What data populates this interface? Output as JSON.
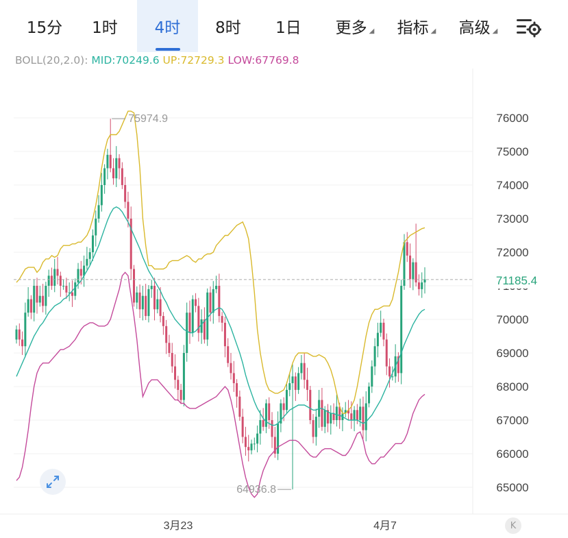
{
  "tabs": [
    {
      "label": "15分",
      "active": false,
      "dropdown": false
    },
    {
      "label": "1时",
      "active": false,
      "dropdown": false
    },
    {
      "label": "4时",
      "active": true,
      "dropdown": false
    },
    {
      "label": "8时",
      "active": false,
      "dropdown": false
    },
    {
      "label": "1日",
      "active": false,
      "dropdown": false
    },
    {
      "label": "更多",
      "active": false,
      "dropdown": true
    },
    {
      "label": "指标",
      "active": false,
      "dropdown": true
    },
    {
      "label": "高级",
      "active": false,
      "dropdown": true
    }
  ],
  "toolbar": {
    "settings_icon": "chart-settings-icon"
  },
  "indicator": {
    "name": "BOLL(20,2.0):",
    "mid_label": "MID:70249.6",
    "up_label": "UP:72729.3",
    "low_label": "LOW:67769.8"
  },
  "colors": {
    "up": "#27a37a",
    "down": "#d24f6e",
    "mid": "#2bb3a0",
    "upper": "#d9b92c",
    "lower": "#c44a9b",
    "accent": "#2f6fd6",
    "axis_text": "#444444",
    "current_price": "#27a37a"
  },
  "chart_data": {
    "type": "candlestick",
    "ylim": [
      64500,
      76600
    ],
    "yticks": [
      65000,
      66000,
      67000,
      68000,
      69000,
      70000,
      71000,
      72000,
      73000,
      74000,
      75000,
      76000
    ],
    "xticks": [
      "3月23",
      "4月7"
    ],
    "current_price": "71185.4",
    "max_label": "75974.9",
    "min_label": "64936.8",
    "closes": [
      69700,
      69400,
      69200,
      70200,
      70600,
      70200,
      71000,
      70500,
      70700,
      70400,
      71000,
      71300,
      71000,
      71500,
      71300,
      71000,
      71000,
      70800,
      70800,
      70700,
      71100,
      71500,
      71300,
      71600,
      71800,
      72000,
      72500,
      73000,
      73400,
      74000,
      74500,
      74900,
      74500,
      74200,
      74800,
      74500,
      74000,
      73500,
      73000,
      71500,
      70500,
      70800,
      70300,
      70700,
      70100,
      70900,
      71000,
      70300,
      70600,
      70100,
      69800,
      69300,
      69000,
      68600,
      68200,
      67900,
      67600,
      69000,
      70200,
      69600,
      70600,
      70400,
      69600,
      70000,
      69400,
      70800,
      70200,
      70900,
      71000,
      70100,
      69900,
      69200,
      68700,
      68400,
      68100,
      67700,
      67100,
      66500,
      66200,
      66100,
      66300,
      66300,
      66600,
      67000,
      66800,
      67500,
      67000,
      66500,
      66000,
      66900,
      67500,
      67300,
      67900,
      68100,
      68300,
      67900,
      68400,
      68700,
      68200,
      67900,
      67000,
      66500,
      67100,
      67600,
      66800,
      67300,
      66900,
      67200,
      67000,
      67400,
      67000,
      67200,
      67300,
      67200,
      67000,
      67300,
      67000,
      67400,
      66700,
      67500,
      68000,
      68600,
      69200,
      69600,
      69900,
      69400,
      68600,
      68300,
      68300,
      68900,
      68400,
      71000,
      72300,
      71900,
      71200,
      71700,
      71100,
      70900,
      71100,
      71190
    ],
    "max_high": 75974.9,
    "max_index": 32,
    "min_low": 64936.8,
    "min_index": 94,
    "max_index_2": 136,
    "max_high_2": 72850,
    "gap_index_4": 125,
    "gap_low_4": 69200,
    "mid": [
      68300,
      68500,
      68700,
      68900,
      69100,
      69300,
      69500,
      69650,
      69800,
      69900,
      70050,
      70200,
      70300,
      70400,
      70450,
      70500,
      70600,
      70650,
      70750,
      70850,
      70950,
      71050,
      71150,
      71300,
      71450,
      71600,
      71800,
      72000,
      72200,
      72450,
      72700,
      72950,
      73150,
      73300,
      73350,
      73300,
      73200,
      73050,
      72900,
      72700,
      72500,
      72300,
      72100,
      71850,
      71650,
      71450,
      71300,
      71150,
      71000,
      70850,
      70650,
      70500,
      70300,
      70150,
      70000,
      69900,
      69800,
      69700,
      69650,
      69600,
      69600,
      69650,
      69750,
      69850,
      69950,
      70050,
      70150,
      70250,
      70300,
      70350,
      70300,
      70150,
      69950,
      69750,
      69500,
      69250,
      69000,
      68700,
      68350,
      68050,
      67800,
      67550,
      67350,
      67200,
      67050,
      66950,
      66900,
      66850,
      66850,
      66900,
      67000,
      67100,
      67200,
      67300,
      67350,
      67400,
      67450,
      67450,
      67450,
      67400,
      67350,
      67300,
      67300,
      67350,
      67350,
      67300,
      67250,
      67200,
      67200,
      67150,
      67150,
      67100,
      67050,
      67000,
      67000,
      67000,
      67000,
      66950,
      66900,
      66950,
      67050,
      67150,
      67300,
      67450,
      67600,
      67800,
      68000,
      68200,
      68400,
      68600,
      68800,
      69000,
      69250,
      69450,
      69650,
      69850,
      70000,
      70150,
      70250,
      70300
    ],
    "upper": [
      71100,
      71200,
      71350,
      71500,
      71550,
      71550,
      71550,
      71400,
      71500,
      71700,
      71800,
      71800,
      71900,
      71850,
      71900,
      72100,
      72200,
      72200,
      72200,
      72250,
      72250,
      72300,
      72300,
      72400,
      72500,
      72700,
      73000,
      73400,
      73900,
      74500,
      75000,
      75350,
      75500,
      75500,
      75500,
      75600,
      75800,
      76000,
      76200,
      76200,
      76150,
      75500,
      74500,
      73000,
      72200,
      71600,
      71600,
      71500,
      71500,
      71500,
      71500,
      71550,
      71700,
      71750,
      71750,
      71750,
      71800,
      71850,
      71900,
      71850,
      71750,
      71700,
      71800,
      71800,
      71900,
      71950,
      71950,
      72000,
      72200,
      72300,
      72400,
      72500,
      72500,
      72600,
      72700,
      72800,
      72850,
      72900,
      72700,
      72400,
      71700,
      70800,
      69700,
      69000,
      68500,
      68100,
      67900,
      67850,
      67800,
      67800,
      67850,
      67900,
      68100,
      68400,
      68700,
      68900,
      69000,
      69000,
      69000,
      69000,
      68950,
      68900,
      68900,
      68950,
      68900,
      68850,
      68700,
      68500,
      68200,
      67800,
      67400,
      67200,
      67200,
      67300,
      67400,
      67600,
      68000,
      68500,
      69000,
      69500,
      69900,
      70150,
      70300,
      70300,
      70350,
      70400,
      70400,
      70400,
      70600,
      71000,
      71400,
      71900,
      72300,
      72400,
      72500,
      72550,
      72600,
      72650,
      72700,
      72729
    ],
    "lower": [
      65200,
      65300,
      65600,
      66100,
      66700,
      67400,
      68000,
      68400,
      68600,
      68700,
      68700,
      68700,
      68800,
      68900,
      69000,
      69100,
      69100,
      69150,
      69200,
      69300,
      69400,
      69550,
      69700,
      69800,
      69850,
      69900,
      69900,
      69850,
      69800,
      69800,
      69800,
      69850,
      70000,
      70300,
      70600,
      70900,
      71300,
      71400,
      71300,
      70700,
      70100,
      69400,
      68500,
      67700,
      67900,
      68100,
      68200,
      68200,
      68200,
      68100,
      68000,
      67900,
      67800,
      67700,
      67600,
      67600,
      67500,
      67500,
      67400,
      67350,
      67350,
      67350,
      67400,
      67450,
      67500,
      67550,
      67600,
      67650,
      67700,
      67800,
      67900,
      68000,
      67900,
      67600,
      67200,
      66700,
      66200,
      65700,
      65300,
      65000,
      64800,
      64700,
      64800,
      65200,
      65500,
      65700,
      65900,
      66000,
      66100,
      66200,
      66250,
      66300,
      66350,
      66400,
      66400,
      66400,
      66350,
      66250,
      66150,
      66050,
      65950,
      65900,
      65900,
      66000,
      66100,
      66150,
      66150,
      66150,
      66100,
      66050,
      66000,
      65950,
      65950,
      66050,
      66200,
      66400,
      66600,
      66650,
      66400,
      66000,
      65800,
      65700,
      65700,
      65800,
      65900,
      65900,
      66000,
      66100,
      66200,
      66300,
      66300,
      66300,
      66400,
      66600,
      66900,
      67200,
      67400,
      67600,
      67700,
      67770
    ]
  }
}
